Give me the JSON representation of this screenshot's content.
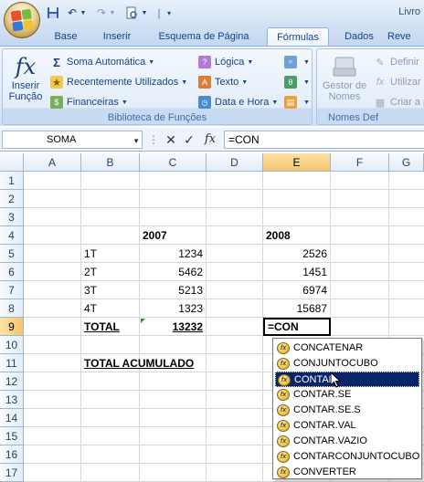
{
  "window": {
    "title": "Livro"
  },
  "tabs": [
    "Base",
    "Inserir",
    "Esquema de Página",
    "Fórmulas",
    "Dados",
    "Reve"
  ],
  "active_tab": "Fórmulas",
  "ribbon": {
    "insert_function": {
      "line1": "Inserir",
      "line2": "Função"
    },
    "library": {
      "autosum": "Soma Automática",
      "recent": "Recentemente Utilizados",
      "financial": "Financeiras",
      "logical": "Lógica",
      "text": "Texto",
      "date_time": "Data e Hora",
      "label": "Biblioteca de Funções"
    },
    "names": {
      "manager_line1": "Gestor de",
      "manager_line2": "Nomes",
      "define": "Definir",
      "use": "Utilizar",
      "create": "Criar a p",
      "label": "Nomes Def"
    }
  },
  "formula_bar": {
    "name_box": "SOMA",
    "fx": "fx",
    "value": "=CON"
  },
  "grid": {
    "columns": [
      "A",
      "B",
      "C",
      "D",
      "E",
      "F",
      "G"
    ],
    "rows": [
      "1",
      "2",
      "3",
      "4",
      "5",
      "6",
      "7",
      "8",
      "9",
      "10",
      "11",
      "12",
      "13",
      "14",
      "15",
      "16",
      "17"
    ],
    "cells": {
      "C4": "2007",
      "E4": "2008",
      "B5": "1T",
      "C5": "1234",
      "E5": "2526",
      "B6": "2T",
      "C6": "5462",
      "E6": "1451",
      "B7": "3T",
      "C7": "5213",
      "E7": "6974",
      "B8": "4T",
      "C8": "1323",
      "E8": "15687",
      "B9": "TOTAL",
      "C9": "13232",
      "E9": "=CON",
      "B11": "TOTAL ACUMULADO"
    }
  },
  "autocomplete": {
    "items": [
      "CONCATENAR",
      "CONJUNTOCUBO",
      "CONTAR",
      "CONTAR.SE",
      "CONTAR.SE.S",
      "CONTAR.VAL",
      "CONTAR.VAZIO",
      "CONTARCONJUNTOCUBO",
      "CONVERTER"
    ],
    "selected": "CONTAR"
  },
  "colors": {
    "accent": "#15428b",
    "selection": "#0a246a",
    "header_selected": "#f7c56b"
  }
}
